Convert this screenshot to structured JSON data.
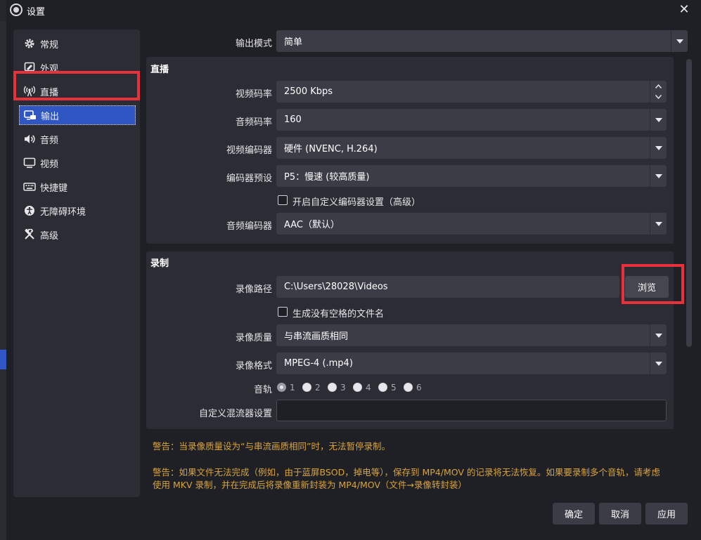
{
  "window": {
    "title": "设置",
    "close": "✕"
  },
  "sidebar": {
    "items": [
      {
        "label": "常规",
        "icon": "gear-icon"
      },
      {
        "label": "外观",
        "icon": "appearance-icon"
      },
      {
        "label": "直播",
        "icon": "broadcast-icon"
      },
      {
        "label": "输出",
        "icon": "output-icon"
      },
      {
        "label": "音频",
        "icon": "speaker-icon"
      },
      {
        "label": "视频",
        "icon": "monitor-icon"
      },
      {
        "label": "快捷键",
        "icon": "keyboard-icon"
      },
      {
        "label": "无障碍环境",
        "icon": "accessibility-icon"
      },
      {
        "label": "高级",
        "icon": "tools-icon"
      }
    ],
    "active_index": 3
  },
  "output_mode": {
    "label": "输出模式",
    "value": "简单"
  },
  "streaming": {
    "title": "直播",
    "video_bitrate": {
      "label": "视频码率",
      "value": "2500 Kbps"
    },
    "audio_bitrate": {
      "label": "音频码率",
      "value": "160"
    },
    "video_encoder": {
      "label": "视频编码器",
      "value": "硬件 (NVENC, H.264)"
    },
    "encoder_preset": {
      "label": "编码器预设",
      "value": "P5：慢速 (较高质量)"
    },
    "custom_encoder": {
      "label": "开启自定义编码器设置（高级）",
      "checked": false
    },
    "audio_encoder": {
      "label": "音频编码器",
      "value": "AAC（默认）"
    }
  },
  "recording": {
    "title": "录制",
    "path": {
      "label": "录像路径",
      "value": "C:\\Users\\28028\\Videos",
      "browse": "浏览"
    },
    "no_space": {
      "label": "生成没有空格的文件名",
      "checked": false
    },
    "quality": {
      "label": "录像质量",
      "value": "与串流画质相同"
    },
    "format": {
      "label": "录像格式",
      "value": "MPEG-4 (.mp4)"
    },
    "tracks": {
      "label": "音轨",
      "options": [
        "1",
        "2",
        "3",
        "4",
        "5",
        "6"
      ],
      "selected": "1"
    },
    "muxer": {
      "label": "自定义混流器设置",
      "value": ""
    }
  },
  "warnings": {
    "w1": "警告：当录像质量设为“与串流画质相同”时，无法暂停录制。",
    "w2_line1": "警告：如果文件无法完成（例如，由于蓝屏BSOD，掉电等），保存到 MP4/MOV 的记录将无法恢复。如果要录制多个音轨，请考虑",
    "w2_line2": "使用 MKV 录制，并在完成后将录像重新封装为 MP4/MOV（文件→录像转封装）"
  },
  "buttons": {
    "ok": "确定",
    "cancel": "取消",
    "apply": "应用"
  },
  "colors": {
    "accent": "#2f56c2",
    "highlight": "#e8313b",
    "warning": "#d9a43a"
  }
}
